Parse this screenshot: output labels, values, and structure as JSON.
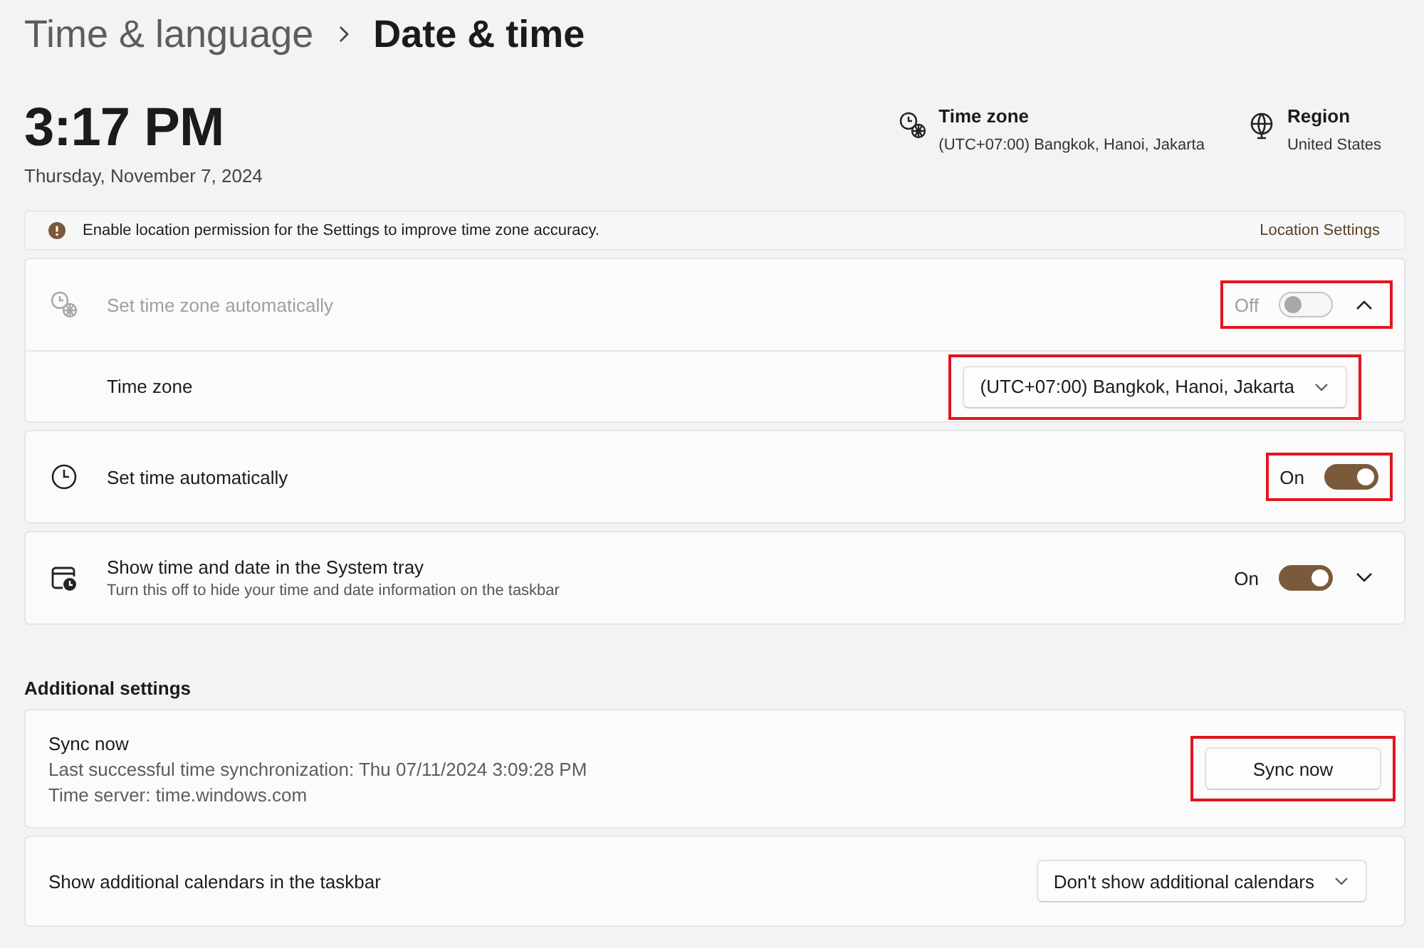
{
  "breadcrumb": {
    "parent": "Time & language",
    "current": "Date & time"
  },
  "clock": {
    "time": "3:17 PM",
    "date": "Thursday, November 7, 2024"
  },
  "summary": [
    {
      "label": "Time zone",
      "value": "(UTC+07:00) Bangkok, Hanoi, Jakarta"
    },
    {
      "label": "Region",
      "value": "United States"
    }
  ],
  "banner": {
    "message": "Enable location permission for the Settings to improve time zone accuracy.",
    "link": "Location Settings"
  },
  "cards": [
    {
      "label": "Set time zone automatically",
      "disabled": true,
      "state_text": "Off",
      "on": false,
      "expanded": true,
      "highlighted": true,
      "children": [
        {
          "label": "Time zone",
          "value": "(UTC+07:00) Bangkok, Hanoi, Jakarta",
          "highlighted": true
        }
      ]
    },
    {
      "label": "Set time automatically",
      "disabled": false,
      "state_text": "On",
      "on": true,
      "highlighted": true
    },
    {
      "label": "Show time and date in the System tray",
      "description": "Turn this off to hide your time and date information on the taskbar",
      "disabled": false,
      "state_text": "On",
      "on": true,
      "expanded": false,
      "highlighted": false
    }
  ],
  "additional_settings": {
    "heading": "Additional settings",
    "cards": [
      {
        "kind": "button",
        "title": "Sync now",
        "lines": [
          "Last successful time synchronization: Thu 07/11/2024 3:09:28 PM",
          "Time server: time.windows.com"
        ],
        "button": "Sync now",
        "highlighted": true
      },
      {
        "kind": "dropdown",
        "title": "Show additional calendars in the taskbar",
        "value": "Don't show additional calendars",
        "highlighted": false
      }
    ]
  }
}
